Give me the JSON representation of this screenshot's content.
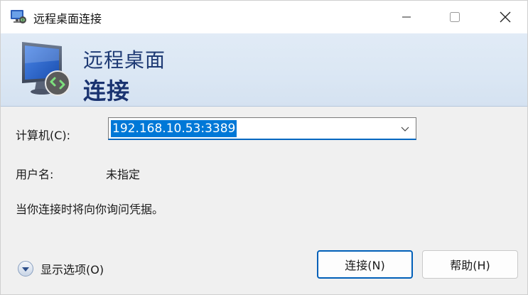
{
  "window": {
    "title": "远程桌面连接",
    "icon": "remote-desktop-icon",
    "controls": [
      "minimize-icon",
      "maximize-icon",
      "close-icon"
    ]
  },
  "banner": {
    "line1": "远程桌面",
    "line2": "连接",
    "icon": "monitor-connection-icon"
  },
  "form": {
    "computer_label": "计算机(C):",
    "computer_value": "192.168.10.53:3389",
    "user_label": "用户名:",
    "user_value": "未指定",
    "info_text": "当你连接时将向你询问凭据。"
  },
  "footer": {
    "options_label": "显示选项(O)",
    "connect_label": "连接(N)",
    "help_label": "帮助(H)"
  },
  "colors": {
    "accent": "#0078d7",
    "banner_text": "#1e3a74",
    "banner_bg": "#dbe7f4"
  }
}
